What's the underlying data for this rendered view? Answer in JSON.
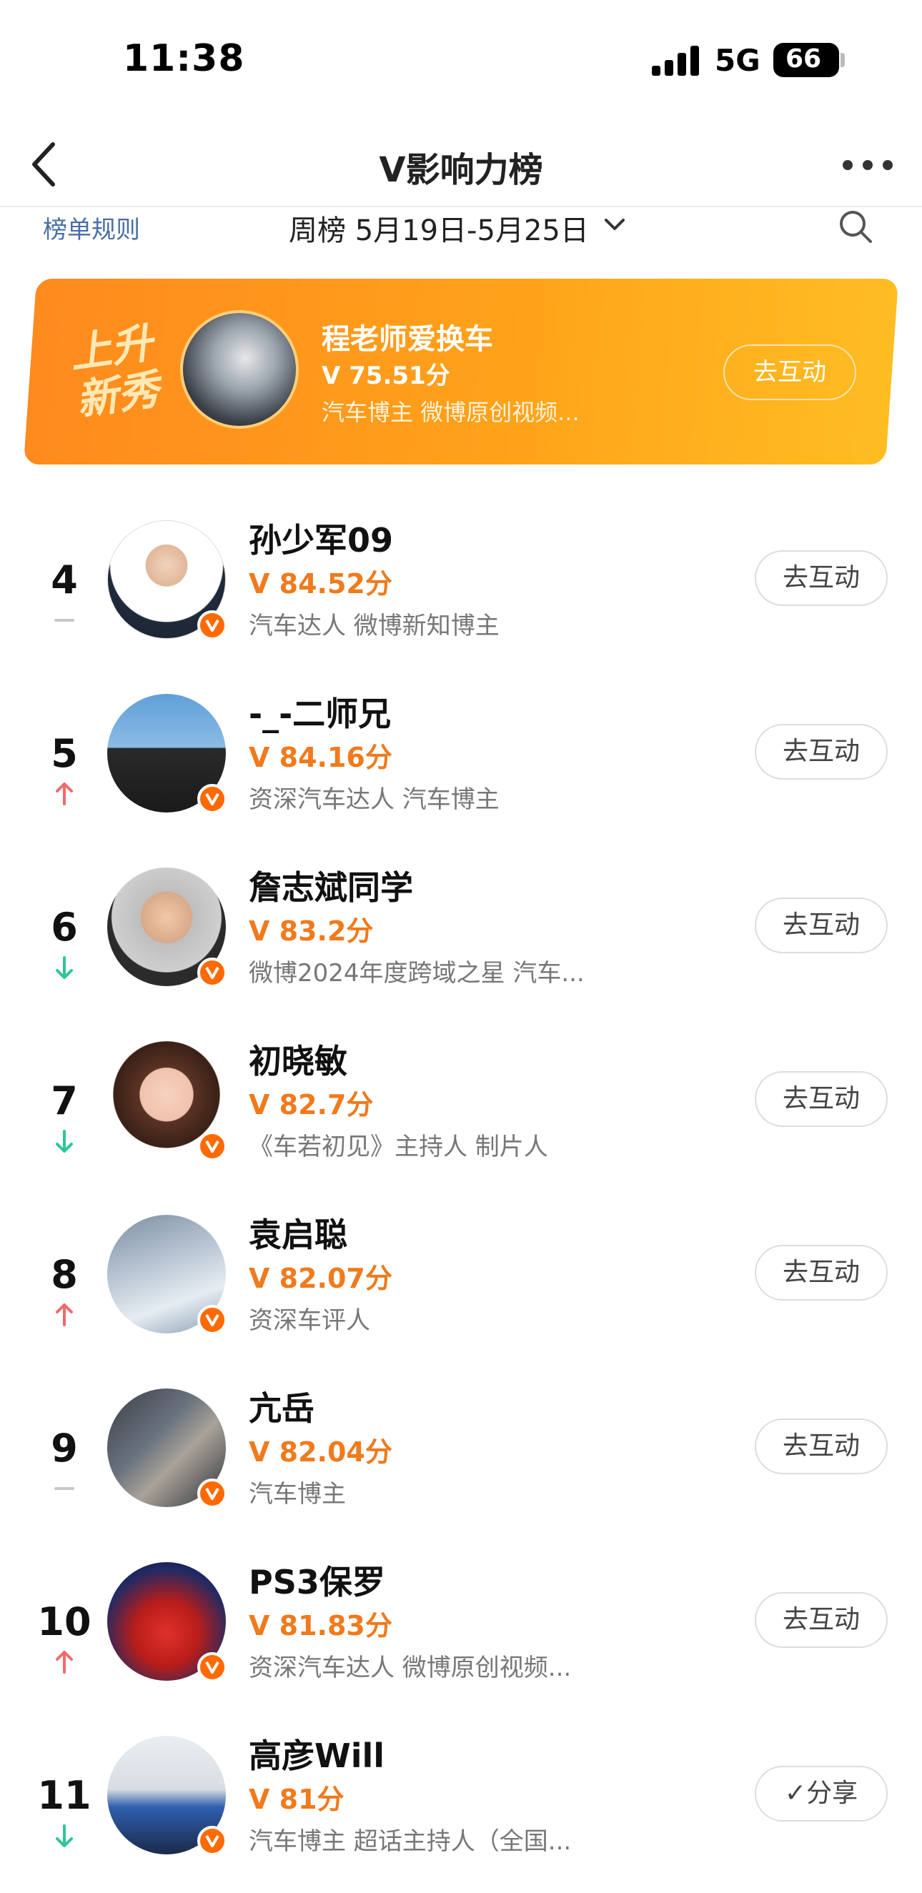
{
  "status_bar": {
    "time": "11:38",
    "network": "5G",
    "battery": "66"
  },
  "nav": {
    "title": "V影响力榜"
  },
  "filter": {
    "rules": "榜单规则",
    "week": "周榜 5月19日-5月25日"
  },
  "banner": {
    "tag": "上升新秀",
    "name": "程老师爱换车",
    "score": "V 75.51分",
    "desc": "汽车博主 微博原创视频...",
    "button": "去互动"
  },
  "colors": {
    "accent": "#f07a1c",
    "up": "#f06a6a",
    "down": "#2fc49a",
    "same": "#c8c8c8"
  },
  "rows": [
    {
      "rank": "4",
      "trend": "same",
      "name": "孙少军09",
      "score": "V 84.52分",
      "desc": "汽车达人 微博新知博主",
      "button": "去互动"
    },
    {
      "rank": "5",
      "trend": "up",
      "name": "-_-二师兄",
      "score": "V 84.16分",
      "desc": "资深汽车达人 汽车博主",
      "button": "去互动"
    },
    {
      "rank": "6",
      "trend": "down",
      "name": "詹志斌同学",
      "score": "V 83.2分",
      "desc": "微博2024年度跨域之星 汽车...",
      "button": "去互动"
    },
    {
      "rank": "7",
      "trend": "down",
      "name": "初晓敏",
      "score": "V 82.7分",
      "desc": "《车若初见》主持人 制片人",
      "button": "去互动"
    },
    {
      "rank": "8",
      "trend": "up",
      "name": "袁启聪",
      "score": "V 82.07分",
      "desc": "资深车评人",
      "button": "去互动"
    },
    {
      "rank": "9",
      "trend": "same",
      "name": "亢岳",
      "score": "V 82.04分",
      "desc": "汽车博主",
      "button": "去互动"
    },
    {
      "rank": "10",
      "trend": "up",
      "name": "PS3保罗",
      "score": "V 81.83分",
      "desc": "资深汽车达人 微博原创视频...",
      "button": "去互动"
    },
    {
      "rank": "11",
      "trend": "down",
      "name": "高彦Will",
      "score": "V 81分",
      "desc": "汽车博主 超话主持人（全国...",
      "button": "✓分享"
    }
  ]
}
